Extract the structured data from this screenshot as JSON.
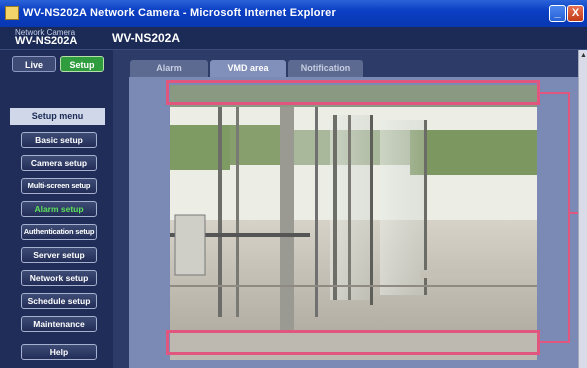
{
  "window": {
    "title": "WV-NS202A Network Camera - Microsoft Internet Explorer",
    "minimize_glyph": "_",
    "close_glyph": "X"
  },
  "header": {
    "brand_top": "Network Camera",
    "brand_main": "WV-NS202A",
    "model": "WV-NS202A"
  },
  "mode": {
    "live_label": "Live",
    "setup_label": "Setup"
  },
  "sidebar": {
    "menu_title": "Setup menu",
    "items": [
      {
        "label": "Basic setup"
      },
      {
        "label": "Camera setup"
      },
      {
        "label": "Multi-screen setup"
      },
      {
        "label": "Alarm setup"
      },
      {
        "label": "Authentication setup"
      },
      {
        "label": "Server setup"
      },
      {
        "label": "Network setup"
      },
      {
        "label": "Schedule setup"
      },
      {
        "label": "Maintenance"
      },
      {
        "label": "Help"
      }
    ],
    "active_item": "Alarm setup"
  },
  "tabs": [
    {
      "label": "Alarm"
    },
    {
      "label": "VMD area"
    },
    {
      "label": "Notification"
    }
  ],
  "active_tab": "VMD area",
  "colors": {
    "highlight": "#e0567e",
    "active_green": "#2f9c3e",
    "active_text": "#5be05b"
  }
}
